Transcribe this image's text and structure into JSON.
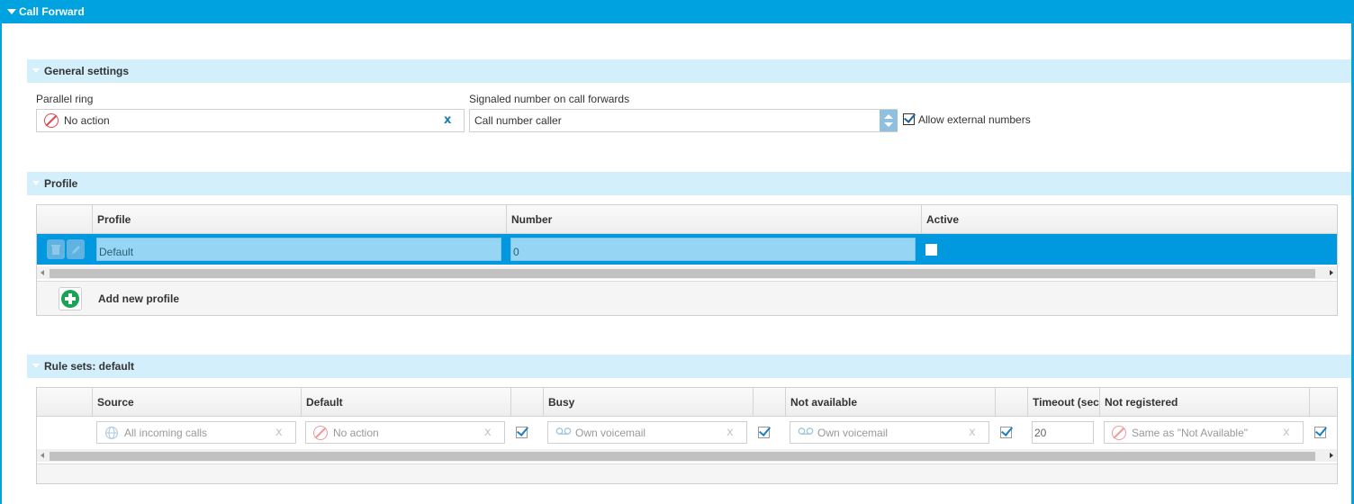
{
  "panel": {
    "title": "Call Forward"
  },
  "general": {
    "title": "General settings",
    "parallel_ring_label": "Parallel ring",
    "parallel_ring_value": "No action",
    "clear_label": "x",
    "signaled_label": "Signaled number on call forwards",
    "signaled_value": "Call number caller",
    "allow_external_label": "Allow external numbers",
    "allow_external_checked": true
  },
  "profile": {
    "title": "Profile",
    "columns": [
      "Profile",
      "Number",
      "Active"
    ],
    "rows": [
      {
        "profile": "Default",
        "number": "0",
        "active": false,
        "selected": true
      }
    ],
    "add_label": "Add new profile"
  },
  "rules": {
    "title": "Rule sets: default",
    "columns": [
      "Source",
      "Default",
      "Busy",
      "Not available",
      "Timeout (sec",
      "Not registered"
    ],
    "row": {
      "source": "All incoming calls",
      "default": "No action",
      "default_checked": true,
      "busy": "Own voicemail",
      "busy_checked": true,
      "not_available": "Own voicemail",
      "not_available_checked": true,
      "timeout": "20",
      "not_registered": "Same as \"Not Available\"",
      "not_registered_checked": true
    },
    "clear_label": "x"
  },
  "colors": {
    "title_bar": "#00a2e0",
    "section_bg": "#d2effb",
    "selected_row": "#0098df",
    "add_green": "#1aa355",
    "no_action_red": "#e0474c"
  }
}
